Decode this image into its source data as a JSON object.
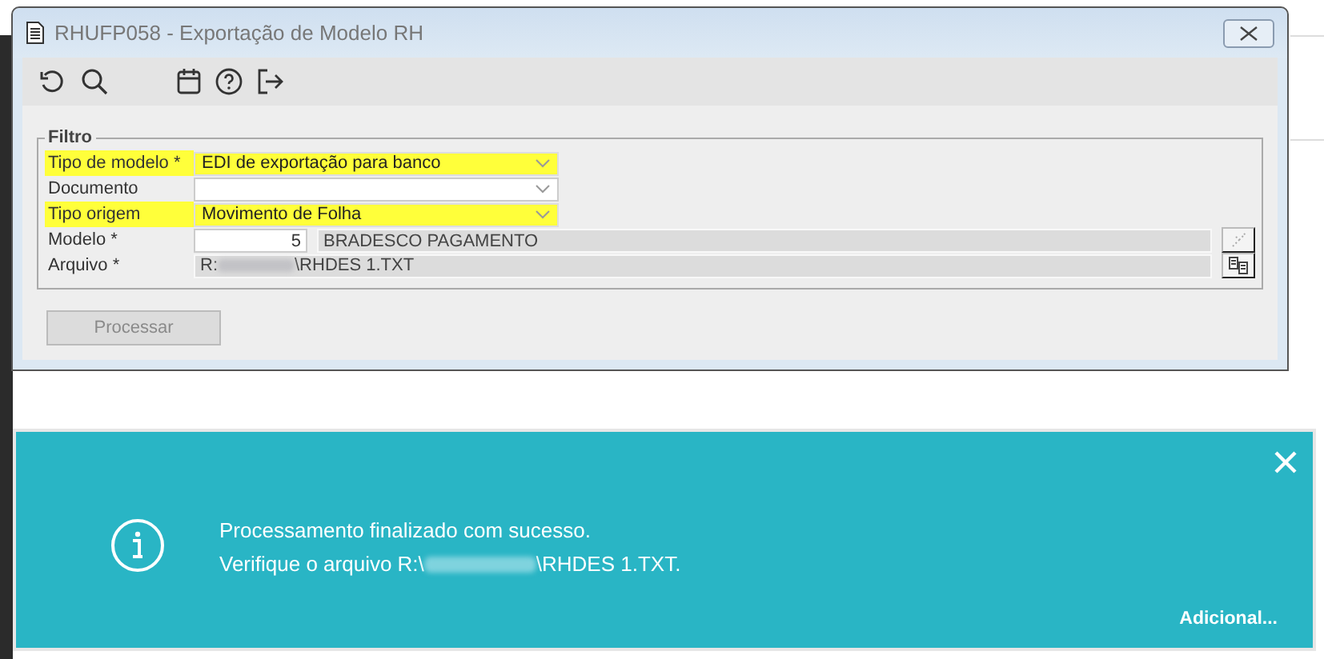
{
  "window": {
    "title": "RHUFP058 - Exportação de Modelo RH"
  },
  "filter": {
    "legend": "Filtro",
    "fields": [
      {
        "kind": "dropdown",
        "label": "Tipo de modelo *",
        "value": "EDI de exportação para banco",
        "highlighted": true
      },
      {
        "kind": "dropdown",
        "label": "Documento",
        "highlighted": false
      },
      {
        "kind": "dropdown",
        "label": "Tipo origem",
        "value": "Movimento de Folha",
        "highlighted": true
      },
      {
        "kind": "code",
        "label": "Modelo *",
        "value": "5",
        "description": "BRADESCO PAGAMENTO",
        "highlighted": false
      },
      {
        "kind": "path",
        "label": "Arquivo *",
        "value_start": "R:",
        "value_end": "\\RHDES 1.TXT",
        "highlighted": false
      }
    ]
  },
  "process_button": {
    "label": "Processar",
    "disabled": true
  },
  "notification": {
    "line_1": "Processamento finalizado com sucesso.",
    "line_2_start": "Verifique o arquivo R:\\",
    "line_2_end": "\\RHDES 1.TXT.",
    "more_link": "Adicional..."
  }
}
